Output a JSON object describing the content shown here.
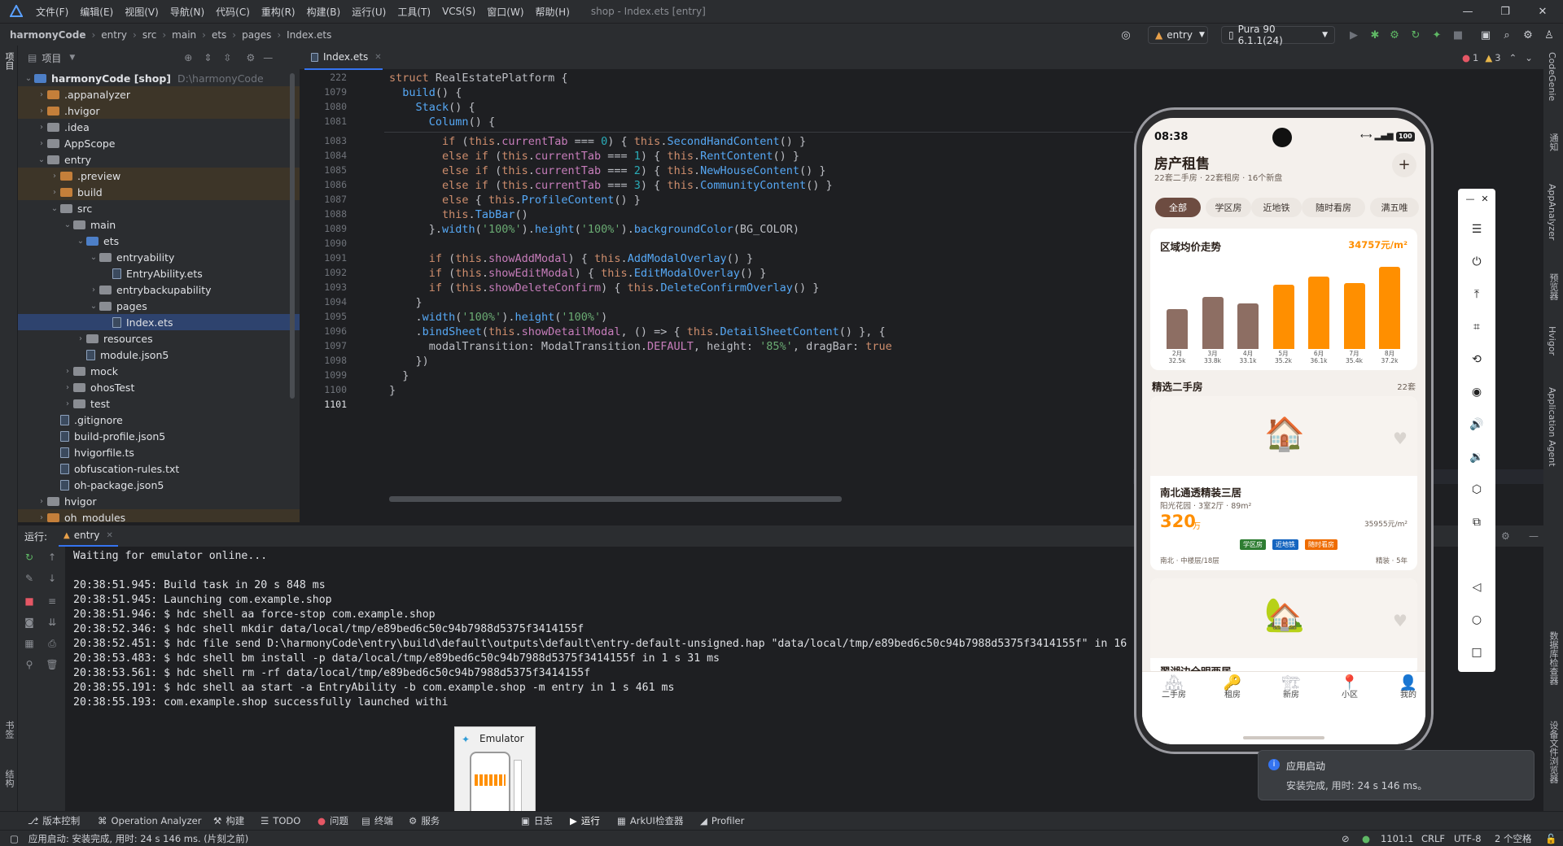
{
  "menu": {
    "items": [
      "文件(F)",
      "编辑(E)",
      "视图(V)",
      "导航(N)",
      "代码(C)",
      "重构(R)",
      "构建(B)",
      "运行(U)",
      "工具(T)",
      "VCS(S)",
      "窗口(W)",
      "帮助(H)"
    ],
    "title": "shop - Index.ets [entry]"
  },
  "breadcrumb": [
    "harmonyCode",
    "entry",
    "src",
    "main",
    "ets",
    "pages",
    "Index.ets"
  ],
  "toolbar": {
    "run_config": "entry",
    "device": "Pura 90 6.1.1(24)"
  },
  "project": {
    "header": "项目",
    "tree": [
      {
        "label": "harmonyCode [shop]",
        "path": "D:\\harmonyCode",
        "depth": 0,
        "open": true,
        "kind": "root"
      },
      {
        "label": ".appanalyzer",
        "depth": 1,
        "kind": "folder-o",
        "sel": false
      },
      {
        "label": ".hvigor",
        "depth": 1,
        "kind": "folder-o"
      },
      {
        "label": ".idea",
        "depth": 1,
        "kind": "folder"
      },
      {
        "label": "AppScope",
        "depth": 1,
        "kind": "folder"
      },
      {
        "label": "entry",
        "depth": 1,
        "kind": "folder",
        "open": true
      },
      {
        "label": ".preview",
        "depth": 2,
        "kind": "folder-o"
      },
      {
        "label": "build",
        "depth": 2,
        "kind": "folder-o"
      },
      {
        "label": "src",
        "depth": 2,
        "kind": "folder",
        "open": true
      },
      {
        "label": "main",
        "depth": 3,
        "kind": "folder",
        "open": true
      },
      {
        "label": "ets",
        "depth": 4,
        "kind": "folder-b",
        "open": true
      },
      {
        "label": "entryability",
        "depth": 5,
        "kind": "folder",
        "open": true
      },
      {
        "label": "EntryAbility.ets",
        "depth": 6,
        "kind": "file"
      },
      {
        "label": "entrybackupability",
        "depth": 5,
        "kind": "folder"
      },
      {
        "label": "pages",
        "depth": 5,
        "kind": "folder",
        "open": true
      },
      {
        "label": "Index.ets",
        "depth": 6,
        "kind": "file",
        "sel": true
      },
      {
        "label": "resources",
        "depth": 4,
        "kind": "folder"
      },
      {
        "label": "module.json5",
        "depth": 4,
        "kind": "file"
      },
      {
        "label": "mock",
        "depth": 3,
        "kind": "folder"
      },
      {
        "label": "ohosTest",
        "depth": 3,
        "kind": "folder"
      },
      {
        "label": "test",
        "depth": 3,
        "kind": "folder"
      },
      {
        "label": ".gitignore",
        "depth": 2,
        "kind": "file"
      },
      {
        "label": "build-profile.json5",
        "depth": 2,
        "kind": "file"
      },
      {
        "label": "hvigorfile.ts",
        "depth": 2,
        "kind": "file"
      },
      {
        "label": "obfuscation-rules.txt",
        "depth": 2,
        "kind": "file"
      },
      {
        "label": "oh-package.json5",
        "depth": 2,
        "kind": "file"
      },
      {
        "label": "hvigor",
        "depth": 1,
        "kind": "folder"
      },
      {
        "label": "oh_modules",
        "depth": 1,
        "kind": "folder-o"
      }
    ]
  },
  "editor": {
    "tab": "Index.ets",
    "status": {
      "errors": "1",
      "warnings": "3"
    },
    "lines": [
      {
        "n": "222",
        "html": "<span class='kw'>struct</span> <span class='ty'>RealEstatePlatform</span> {"
      },
      {
        "n": "1079",
        "html": "  <span class='fn'>build</span>() {"
      },
      {
        "n": "1080",
        "html": "    <span class='fn'>Stack</span>() {"
      },
      {
        "n": "1081",
        "html": "      <span class='fn'>Column</span>() {"
      },
      {
        "n": "1083",
        "html": "        <span class='kw'>if</span> (<span class='kw'>this</span>.<span class='pr'>currentTab</span> === <span class='num'>0</span>) { <span class='kw'>this</span>.<span class='fn'>SecondHandContent</span>() }"
      },
      {
        "n": "1084",
        "html": "        <span class='kw'>else if</span> (<span class='kw'>this</span>.<span class='pr'>currentTab</span> === <span class='num'>1</span>) { <span class='kw'>this</span>.<span class='fn'>RentContent</span>() }"
      },
      {
        "n": "1085",
        "html": "        <span class='kw'>else if</span> (<span class='kw'>this</span>.<span class='pr'>currentTab</span> === <span class='num'>2</span>) { <span class='kw'>this</span>.<span class='fn'>NewHouseContent</span>() }"
      },
      {
        "n": "1086",
        "html": "        <span class='kw'>else if</span> (<span class='kw'>this</span>.<span class='pr'>currentTab</span> === <span class='num'>3</span>) { <span class='kw'>this</span>.<span class='fn'>CommunityContent</span>() }"
      },
      {
        "n": "1087",
        "html": "        <span class='kw'>else</span> { <span class='kw'>this</span>.<span class='fn'>ProfileContent</span>() }"
      },
      {
        "n": "1088",
        "html": "        <span class='kw'>this</span>.<span class='fn'>TabBar</span>()"
      },
      {
        "n": "1089",
        "html": "      }.<span class='fn'>width</span>(<span class='st'>'100%'</span>).<span class='fn'>height</span>(<span class='st'>'100%'</span>).<span class='fn'>backgroundColor</span>(BG_COLOR)"
      },
      {
        "n": "1090",
        "html": ""
      },
      {
        "n": "1091",
        "html": "      <span class='kw'>if</span> (<span class='kw'>this</span>.<span class='pr'>showAddModal</span>) { <span class='kw'>this</span>.<span class='fn'>AddModalOverlay</span>() }"
      },
      {
        "n": "1092",
        "html": "      <span class='kw'>if</span> (<span class='kw'>this</span>.<span class='pr'>showEditModal</span>) { <span class='kw'>this</span>.<span class='fn'>EditModalOverlay</span>() }"
      },
      {
        "n": "1093",
        "html": "      <span class='kw'>if</span> (<span class='kw'>this</span>.<span class='pr'>showDeleteConfirm</span>) { <span class='kw'>this</span>.<span class='fn'>DeleteConfirmOverlay</span>() }"
      },
      {
        "n": "1094",
        "html": "    }"
      },
      {
        "n": "1095",
        "html": "    .<span class='fn'>width</span>(<span class='st'>'100%'</span>).<span class='fn'>height</span>(<span class='st'>'100%'</span>)"
      },
      {
        "n": "1096",
        "html": "    .<span class='fn'>bindSheet</span>(<span class='kw'>this</span>.<span class='pr'>showDetailModal</span>, () => { <span class='kw'>this</span>.<span class='fn'>DetailSheetContent</span>() }, {"
      },
      {
        "n": "1097",
        "html": "      modalTransition: ModalTransition.<span class='pr'>DEFAULT</span>, height: <span class='st'>'85%'</span>, dragBar: <span class='kw'>true</span>"
      },
      {
        "n": "1098",
        "html": "    })"
      },
      {
        "n": "1099",
        "html": "  }"
      },
      {
        "n": "1100",
        "html": "}"
      },
      {
        "n": "1101",
        "html": ""
      }
    ]
  },
  "run": {
    "label": "运行:",
    "tab": "entry",
    "log": [
      "Waiting for emulator online...",
      "",
      "20:38:51.945: Build task in 20 s 848 ms",
      "20:38:51.945: Launching com.example.shop",
      "20:38:51.946: $ hdc shell aa force-stop com.example.shop",
      "20:38:52.346: $ hdc shell mkdir data/local/tmp/e89bed6c50c94b7988d5375f3414155f",
      "20:38:52.451: $ hdc file send D:\\harmonyCode\\entry\\build\\default\\outputs\\default\\entry-default-unsigned.hap \"data/local/tmp/e89bed6c50c94b7988d5375f3414155f\" in 16",
      "20:38:53.483: $ hdc shell bm install -p data/local/tmp/e89bed6c50c94b7988d5375f3414155f in 1 s 31 ms",
      "20:38:53.561: $ hdc shell rm -rf data/local/tmp/e89bed6c50c94b7988d5375f3414155f",
      "20:38:55.191: $ hdc shell aa start -a EntryAbility -b com.example.shop -m entry in 1 s 461 ms",
      "20:38:55.193: com.example.shop successfully launched withi"
    ]
  },
  "bottom_tools": [
    "版本控制",
    "Operation Analyzer",
    "构建",
    "TODO",
    "问题",
    "终端",
    "服务",
    "日志",
    "运行",
    "ArkUI检查器",
    "Profiler"
  ],
  "status": {
    "message": "应用启动: 安装完成, 用时: 24 s 146 ms. (片刻之前)",
    "position": "1101:1",
    "line_sep": "CRLF",
    "encoding": "UTF-8",
    "indent": "2 个空格"
  },
  "right_tools": [
    "CodeGenie",
    "通知",
    "AppAnalyzer",
    "预览器",
    "Hvigor",
    "Application Agent",
    "数据库检查器",
    "设备文件浏览器"
  ],
  "left_tools": [
    "项目",
    "书签",
    "结构"
  ],
  "toast": {
    "title": "应用启动",
    "body": "安装完成, 用时: 24 s 146 ms。"
  },
  "emulator_popup": {
    "title": "Emulator"
  },
  "phone": {
    "time": "08:38",
    "battery": "100",
    "title": "房产租售",
    "subtitle": "22套二手房 · 22套租房 · 16个新盘",
    "chips": [
      "全部",
      "学区房",
      "近地铁",
      "随时看房",
      "满五唯"
    ],
    "price_card": {
      "title": "区域均价走势",
      "current": "34757元/m²"
    },
    "listing_header": {
      "title": "精选二手房",
      "count": "22套"
    },
    "listing1": {
      "name": "南北通透精装三居",
      "meta": "阳光花园 · 3室2厅 · 89m²",
      "price": "320",
      "unit": "万",
      "unit_price": "35955元/m²",
      "tags": [
        "学区房",
        "近地铁",
        "随时看房"
      ],
      "detail_left": "南北 · 中楼层/18层",
      "detail_right": "精装 · 5年"
    },
    "listing2": {
      "name": "翠湖边全明两居"
    },
    "tabs": [
      "二手房",
      "租房",
      "新房",
      "小区",
      "我的"
    ]
  },
  "chart_data": {
    "type": "bar",
    "title": "区域均价走势",
    "categories": [
      "2月",
      "3月",
      "4月",
      "5月",
      "6月",
      "7月",
      "8月"
    ],
    "values": [
      32.5,
      33.8,
      33.1,
      35.2,
      36.1,
      35.4,
      37.2
    ],
    "value_labels": [
      "32.5k",
      "33.8k",
      "33.1k",
      "35.2k",
      "36.1k",
      "35.4k",
      "37.2k"
    ],
    "colors": [
      "#8d6e63",
      "#8d6e63",
      "#8d6e63",
      "#ff8f00",
      "#ff8f00",
      "#ff8f00",
      "#ff8f00"
    ],
    "ylim": [
      28,
      38
    ]
  }
}
